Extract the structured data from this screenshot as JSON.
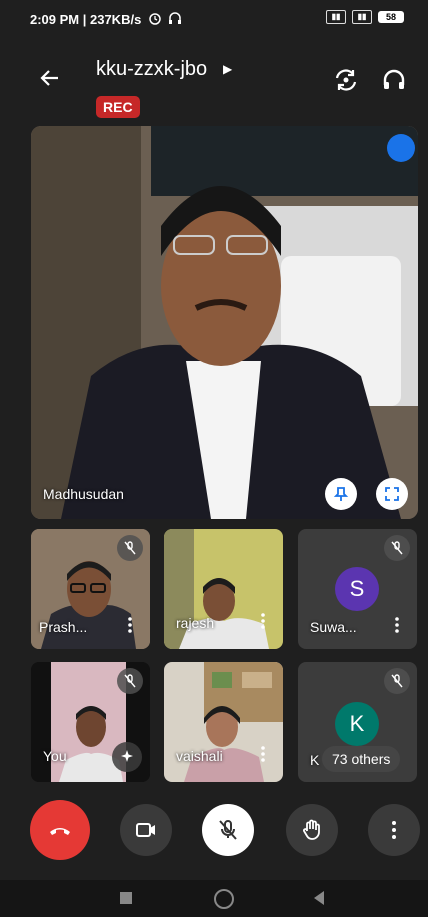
{
  "status_bar": {
    "time": "2:09 PM | 237KB/s",
    "battery": "58"
  },
  "header": {
    "meeting_code": "kku-zzxk-jbo",
    "rec_label": "REC"
  },
  "main_tile": {
    "name": "Madhusudan"
  },
  "participants": [
    {
      "name": "Prash...",
      "muted": true
    },
    {
      "name": "rajesh",
      "muted": false
    },
    {
      "name": "Suwa...",
      "initial": "S",
      "avatar_color": "#5b35b0",
      "muted": true
    },
    {
      "name": "You",
      "muted": true
    },
    {
      "name": "vaishali",
      "muted": false
    },
    {
      "name": "K",
      "initial": "K",
      "avatar_color": "#00796b",
      "muted": true
    }
  ],
  "others_badge": "73 others",
  "colors": {
    "end_call": "#e53935",
    "rec": "#c62828",
    "accent_blue": "#1a73e8"
  }
}
